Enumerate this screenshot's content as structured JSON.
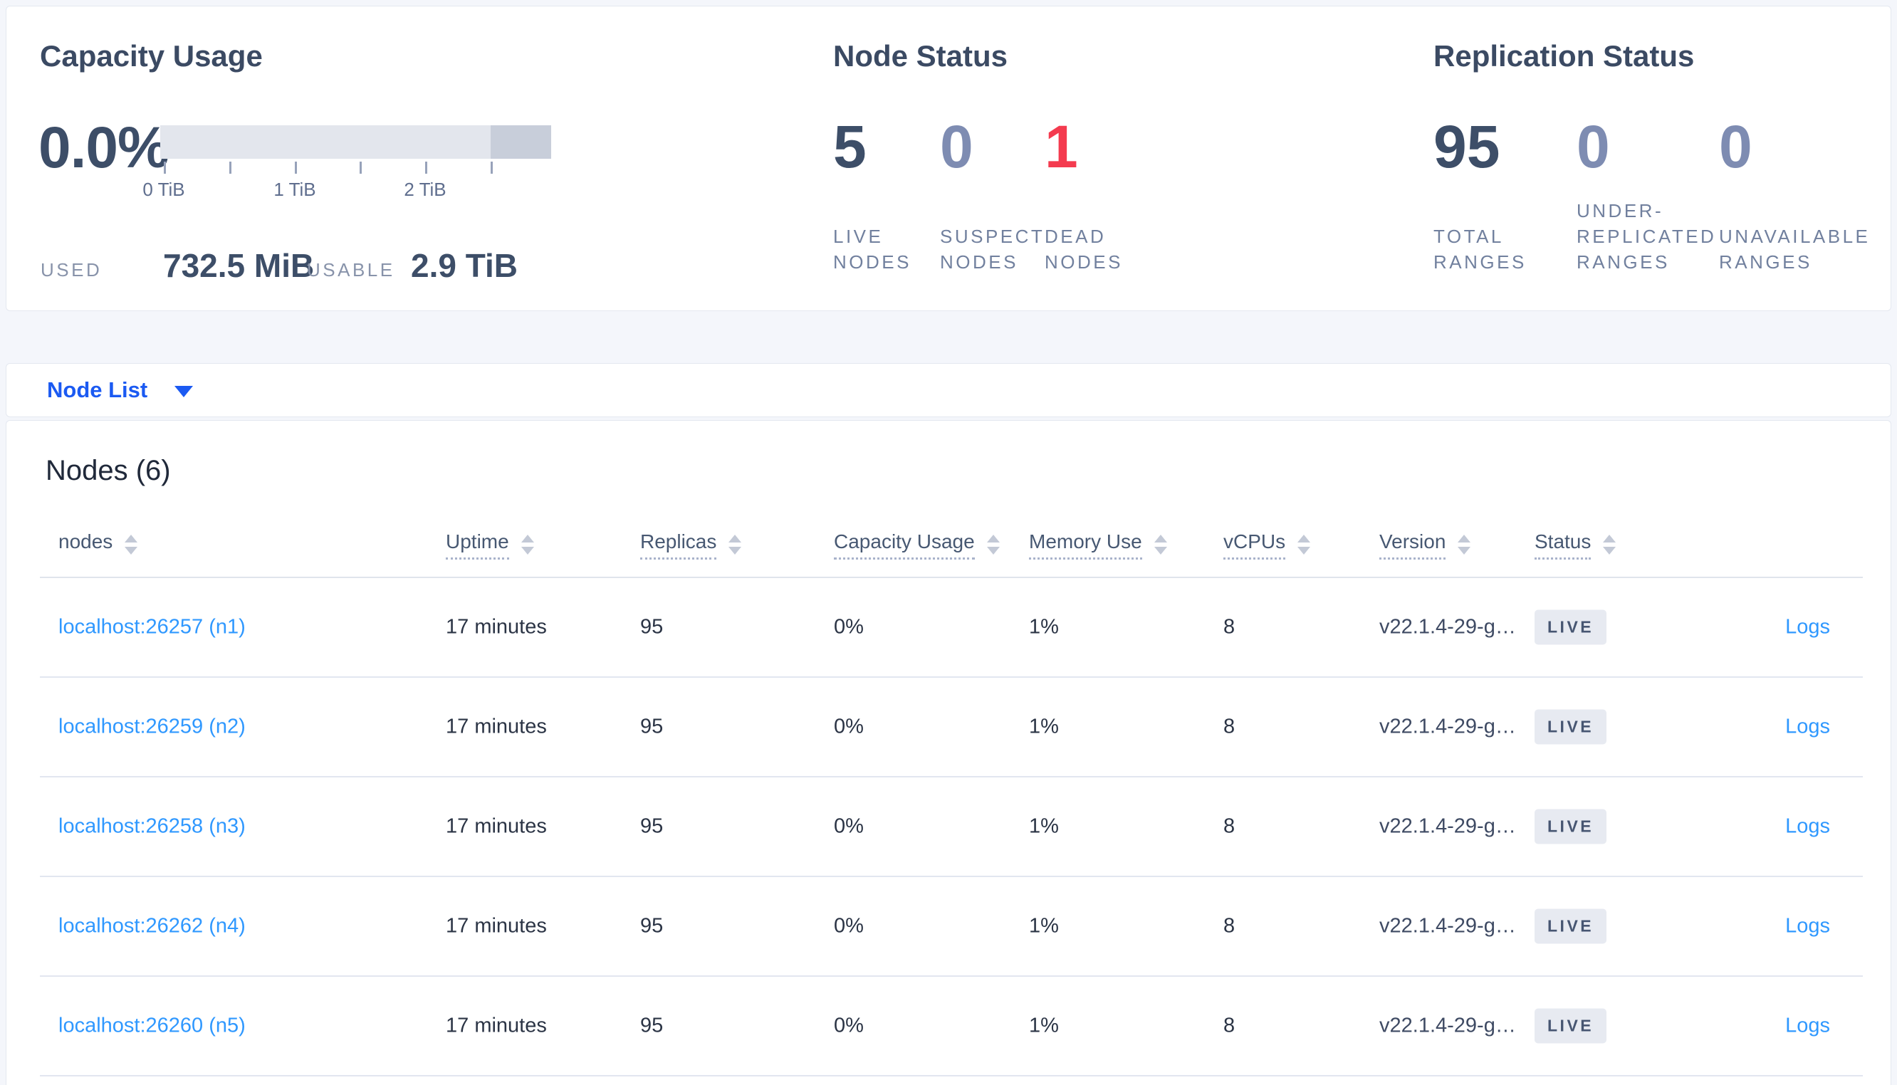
{
  "capacity": {
    "title": "Capacity Usage",
    "percent": "0.0%",
    "tick_labels": [
      "0 TiB",
      "1 TiB",
      "2 TiB"
    ],
    "used_label": "USED",
    "used_value": "732.5 MiB",
    "usable_label": "USABLE",
    "usable_value": "2.9 TiB"
  },
  "node_status": {
    "title": "Node Status",
    "stats": [
      {
        "value": "5",
        "label": "LIVE NODES",
        "tone": "dark"
      },
      {
        "value": "0",
        "label": "SUSPECT NODES",
        "tone": "muted"
      },
      {
        "value": "1",
        "label": "DEAD NODES",
        "tone": "red"
      }
    ]
  },
  "replication_status": {
    "title": "Replication Status",
    "stats": [
      {
        "value": "95",
        "label": "TOTAL RANGES",
        "tone": "dark"
      },
      {
        "value": "0",
        "label": "UNDER-REPLICATED RANGES",
        "tone": "muted"
      },
      {
        "value": "0",
        "label": "UNAVAILABLE RANGES",
        "tone": "muted"
      }
    ]
  },
  "view_selector": {
    "label": "Node List"
  },
  "nodes_table": {
    "title": "Nodes (6)",
    "columns": [
      {
        "key": "nodes",
        "label": "nodes",
        "underlined": false
      },
      {
        "key": "uptime",
        "label": "Uptime",
        "underlined": true
      },
      {
        "key": "replicas",
        "label": "Replicas",
        "underlined": true
      },
      {
        "key": "capacity",
        "label": "Capacity Usage",
        "underlined": true
      },
      {
        "key": "memory",
        "label": "Memory Use",
        "underlined": true
      },
      {
        "key": "vcpus",
        "label": "vCPUs",
        "underlined": true
      },
      {
        "key": "version",
        "label": "Version",
        "underlined": true
      },
      {
        "key": "status",
        "label": "Status",
        "underlined": true
      }
    ],
    "rows": [
      {
        "node": "localhost:26257 (n1)",
        "uptime": "17 minutes",
        "replicas": "95",
        "capacity": "0%",
        "memory": "1%",
        "vcpus": "8",
        "version": "v22.1.4-29-g…",
        "status": "LIVE",
        "logs": "Logs"
      },
      {
        "node": "localhost:26259 (n2)",
        "uptime": "17 minutes",
        "replicas": "95",
        "capacity": "0%",
        "memory": "1%",
        "vcpus": "8",
        "version": "v22.1.4-29-g…",
        "status": "LIVE",
        "logs": "Logs"
      },
      {
        "node": "localhost:26258 (n3)",
        "uptime": "17 minutes",
        "replicas": "95",
        "capacity": "0%",
        "memory": "1%",
        "vcpus": "8",
        "version": "v22.1.4-29-g…",
        "status": "LIVE",
        "logs": "Logs"
      },
      {
        "node": "localhost:26262 (n4)",
        "uptime": "17 minutes",
        "replicas": "95",
        "capacity": "0%",
        "memory": "1%",
        "vcpus": "8",
        "version": "v22.1.4-29-g…",
        "status": "LIVE",
        "logs": "Logs"
      },
      {
        "node": "localhost:26260 (n5)",
        "uptime": "17 minutes",
        "replicas": "95",
        "capacity": "0%",
        "memory": "1%",
        "vcpus": "8",
        "version": "v22.1.4-29-g…",
        "status": "LIVE",
        "logs": "Logs"
      }
    ]
  }
}
